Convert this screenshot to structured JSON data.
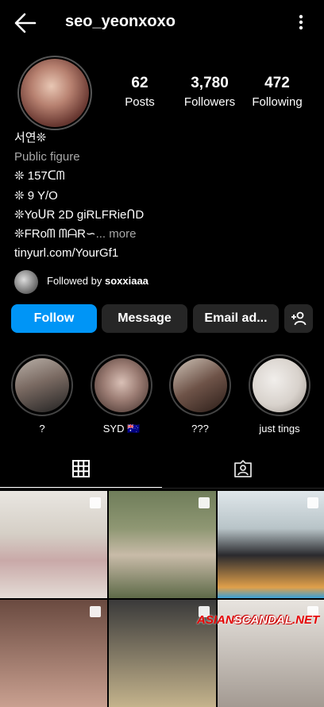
{
  "header": {
    "username": "seo_yeonxoxo"
  },
  "stats": [
    {
      "number": "62",
      "label": "Posts"
    },
    {
      "number": "3,780",
      "label": "Followers"
    },
    {
      "number": "472",
      "label": "Following"
    }
  ],
  "bio": {
    "name": "서연❊",
    "category": "Public figure",
    "line1": "❊ 157ᑕᗰ",
    "line2": "❊ 9 Y/O",
    "line3": "❊YoᑌR 2D giRLFRieᑎD",
    "line4": "❊FRoᗰ ᗰᗩR∽",
    "more": "... more",
    "link": "tinyurl.com/YourGf1"
  },
  "followed_by": {
    "prefix": "Followed by ",
    "user": "soxxiaaa"
  },
  "buttons": {
    "follow": "Follow",
    "message": "Message",
    "email": "Email ad..."
  },
  "highlights": [
    {
      "label": "?"
    },
    {
      "label": "SYD 🇦🇺"
    },
    {
      "label": "???"
    },
    {
      "label": "just tings"
    }
  ],
  "watermark": {
    "part1": "ASIAN",
    "part2": "SCANDAL",
    "part3": ".NET"
  }
}
